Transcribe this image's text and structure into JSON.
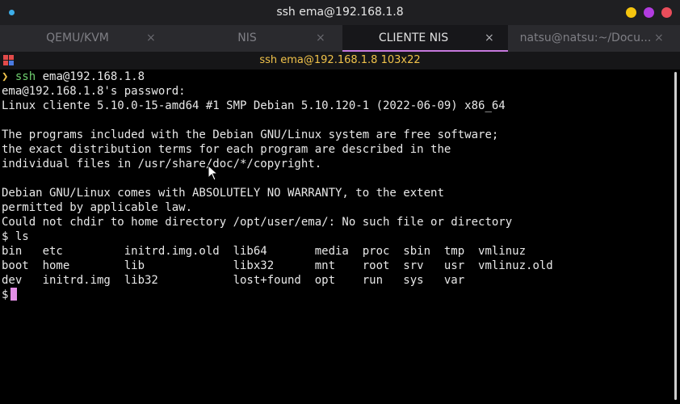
{
  "window": {
    "title": "ssh ema@192.168.1.8"
  },
  "window_buttons": {
    "minimize_color": "#f5c50f",
    "maximize_color": "#b23ce0",
    "close_color": "#ea4d5b"
  },
  "tabs": [
    {
      "label": "QEMU/KVM",
      "close": "×",
      "active": false
    },
    {
      "label": "NIS",
      "close": "×",
      "active": false
    },
    {
      "label": "CLIENTE NIS",
      "close": "×",
      "active": true
    },
    {
      "label": "natsu@natsu:~/Docu...",
      "close": "×",
      "active": false
    }
  ],
  "session": {
    "title": "ssh ema@192.168.1.8 103x22"
  },
  "terminal": {
    "prompt_symbol": "❯",
    "command": "ssh",
    "command_args": "ema@192.168.1.8",
    "lines": [
      "ema@192.168.1.8's password:",
      "Linux cliente 5.10.0-15-amd64 #1 SMP Debian 5.10.120-1 (2022-06-09) x86_64",
      "",
      "The programs included with the Debian GNU/Linux system are free software;",
      "the exact distribution terms for each program are described in the",
      "individual files in /usr/share/doc/*/copyright.",
      "",
      "Debian GNU/Linux comes with ABSOLUTELY NO WARRANTY, to the extent",
      "permitted by applicable law.",
      "Could not chdir to home directory /opt/user/ema/: No such file or directory",
      "$ ls",
      "bin   etc         initrd.img.old  lib64       media  proc  sbin  tmp  vmlinuz",
      "boot  home        lib             libx32      mnt    root  srv   usr  vmlinuz.old",
      "dev   initrd.img  lib32           lost+found  opt    run   sys   var"
    ],
    "current_prompt": "$",
    "cursor_color": "#e38fe6"
  },
  "colors": {
    "accent": "#c678dd",
    "session_title": "#f0c24a",
    "prompt_arrow": "#f0c24a",
    "command": "#6fcf6f"
  }
}
